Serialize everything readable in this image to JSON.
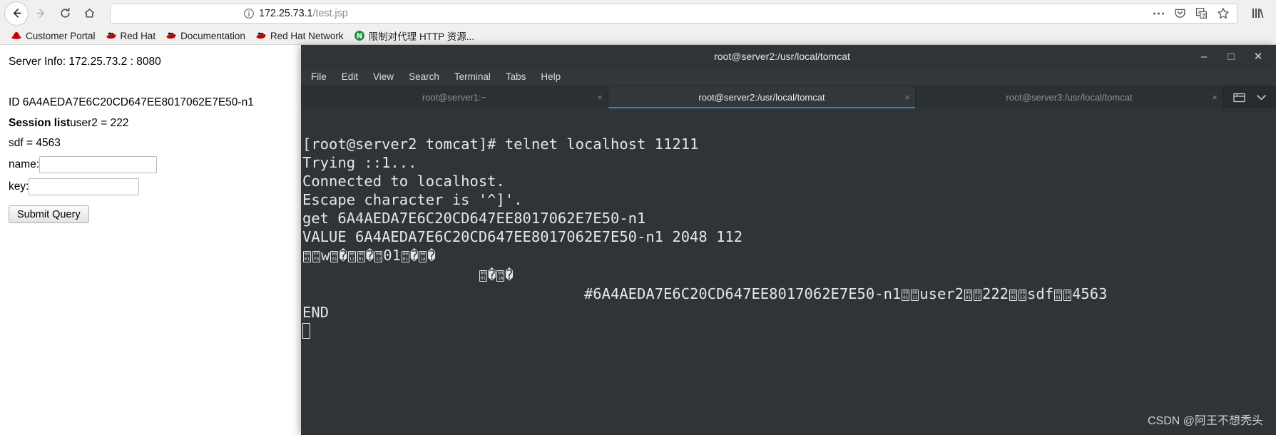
{
  "browser": {
    "back_label": "Back",
    "forward_label": "Forward",
    "reload_label": "Reload",
    "home_label": "Home",
    "url_host": "172.25.73.1",
    "url_path": "/test.jsp",
    "url_full": "172.25.73.1/test.jsp",
    "toolbar_icons": [
      "page-actions-icon",
      "pocket-icon",
      "translate-icon",
      "bookmark-star-icon",
      "library-icon"
    ],
    "bookmarks": [
      {
        "label": "Customer Portal",
        "icon": "redhat-fedora-icon",
        "color": "#cc0000"
      },
      {
        "label": "Red Hat",
        "icon": "redhat-shadowman-icon",
        "color": "#cc0000"
      },
      {
        "label": "Documentation",
        "icon": "redhat-shadowman-icon",
        "color": "#cc0000"
      },
      {
        "label": "Red Hat Network",
        "icon": "redhat-shadowman-icon",
        "color": "#cc0000"
      },
      {
        "label": "限制对代理 HTTP 资源...",
        "icon": "noscript-icon",
        "color": "#23a455"
      }
    ]
  },
  "page": {
    "server_info": "Server Info: 172.25.73.2 : 8080",
    "id_line": "ID 6A4AEDA7E6C20CD647EE8017062E7E50-n1",
    "session_list_label": "Session list",
    "session_entry": "user2 = 222",
    "sdf_line": "sdf = 4563",
    "name_label": "name:",
    "name_value": "",
    "key_label": "key:",
    "key_value": "",
    "submit_label": "Submit Query"
  },
  "terminal": {
    "window_title": "root@server2:/usr/local/tomcat",
    "window_controls": {
      "minimize": "–",
      "maximize": "□",
      "close": "✕"
    },
    "menu": [
      "File",
      "Edit",
      "View",
      "Search",
      "Terminal",
      "Tabs",
      "Help"
    ],
    "tabs": [
      {
        "label": "root@server1:~",
        "active": false,
        "close": "×"
      },
      {
        "label": "root@server2:/usr/local/tomcat",
        "active": true,
        "close": "×"
      },
      {
        "label": "root@server3:/usr/local/tomcat",
        "active": false,
        "close": "×"
      }
    ],
    "tabs_right_icons": [
      "new-tab-icon",
      "tab-list-chevron-down-icon"
    ],
    "lines": [
      "[root@server2 tomcat]# telnet localhost 11211",
      "Trying ::1...",
      "Connected to localhost.",
      "Escape character is '^]'.",
      "get 6A4AEDA7E6C20CD647EE8017062E7E50-n1",
      "VALUE 6A4AEDA7E6C20CD647EE8017062E7E50-n1 2048 112"
    ],
    "binary_line_1_tail": "01",
    "binary_line_3_text": "#6A4AEDA7E6C20CD647EE8017062E7E50-n1",
    "binary_line_3_user": "user2",
    "binary_line_3_num": "222",
    "binary_line_3_sdf": "sdf",
    "binary_line_3_val": "4563",
    "end_line": "END",
    "cursor": "block-cursor"
  },
  "watermark": "CSDN @阿王不想秃头"
}
